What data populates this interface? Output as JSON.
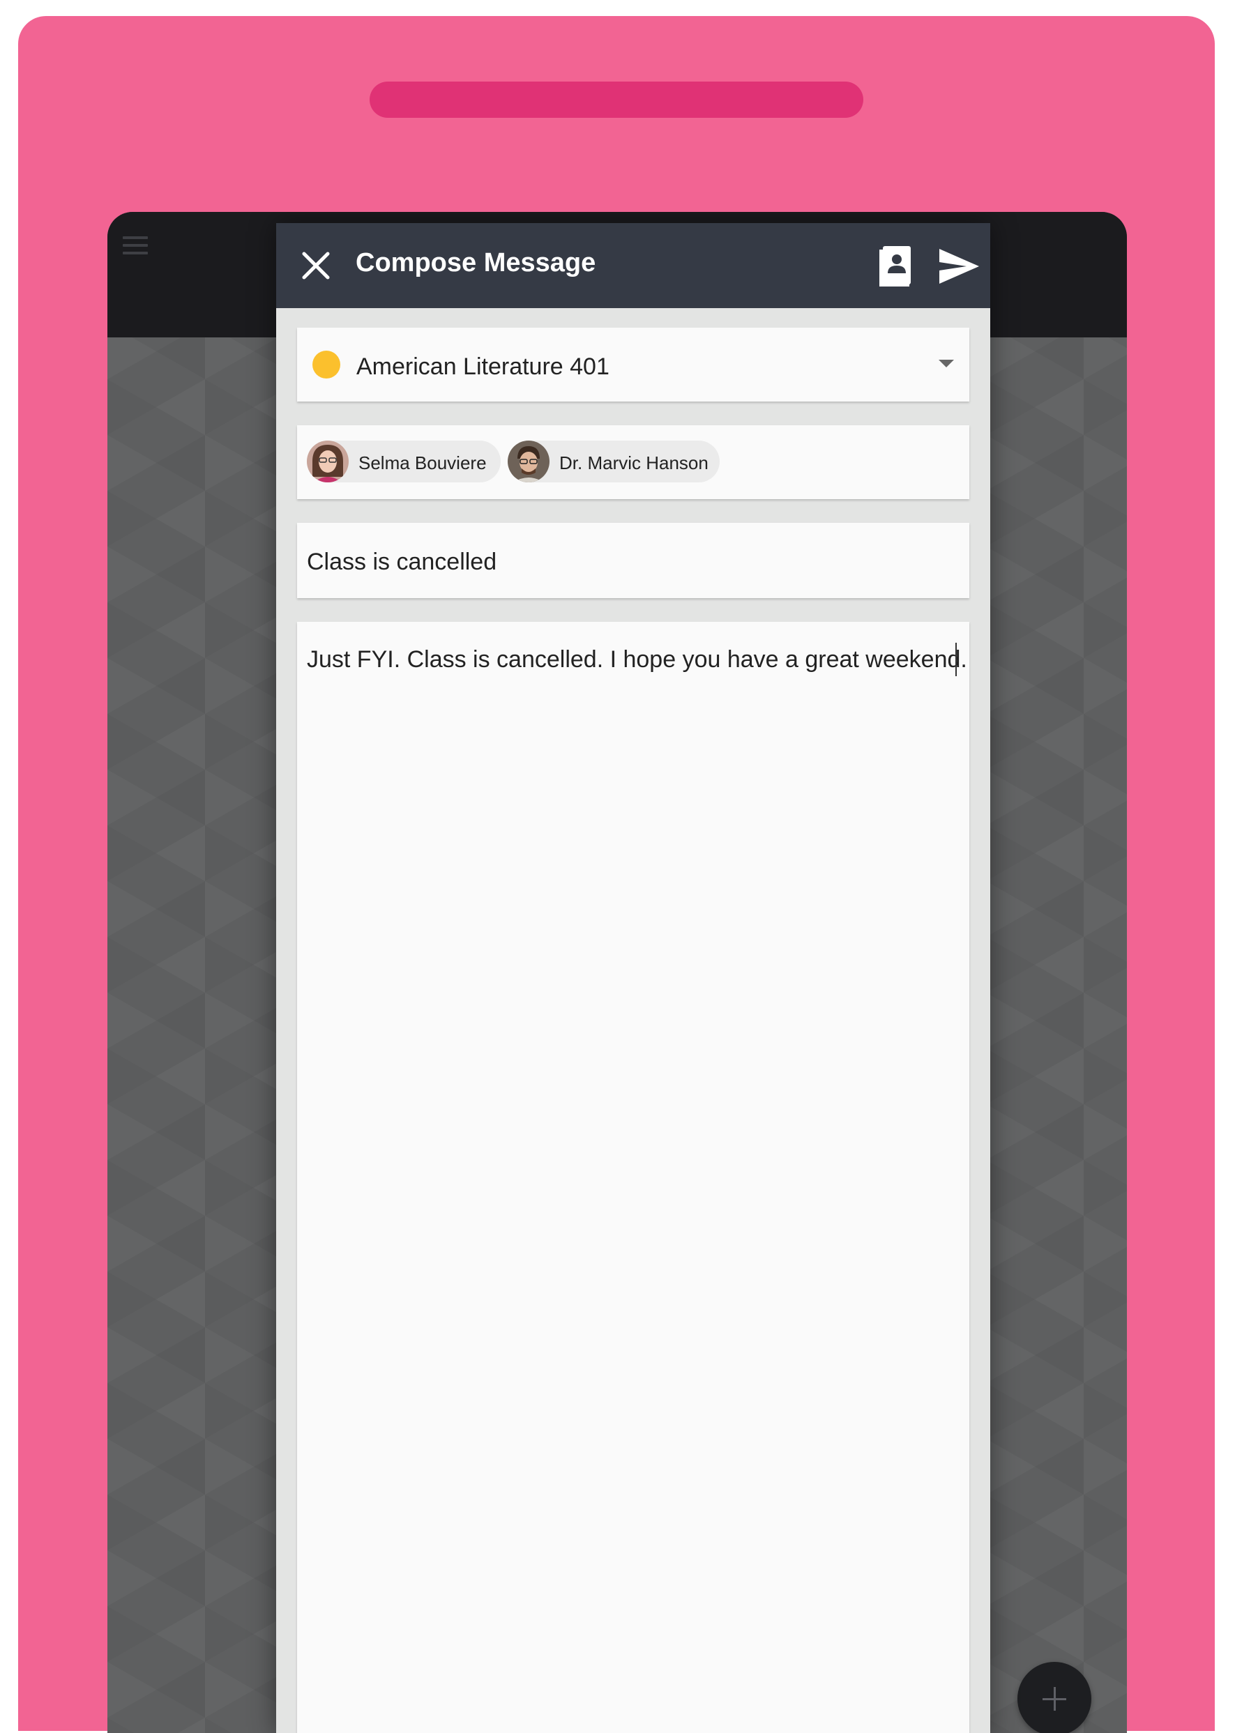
{
  "dialog": {
    "title": "Compose Message",
    "icons": {
      "close": "close-icon",
      "contacts": "contact-book-icon",
      "send": "send-icon"
    }
  },
  "course": {
    "name": "American Literature 401",
    "color": "#fbc02d"
  },
  "recipients": [
    {
      "name": "Selma Bouviere"
    },
    {
      "name": "Dr. Marvic Hanson"
    }
  ],
  "subject": {
    "value": "Class is cancelled"
  },
  "body": {
    "value": "Just FYI. Class is cancelled. I hope you have a great weekend."
  },
  "colors": {
    "device": "#f26493",
    "speaker": "#e03275",
    "header": "#353a45",
    "appbar": "#1b1b1e"
  }
}
